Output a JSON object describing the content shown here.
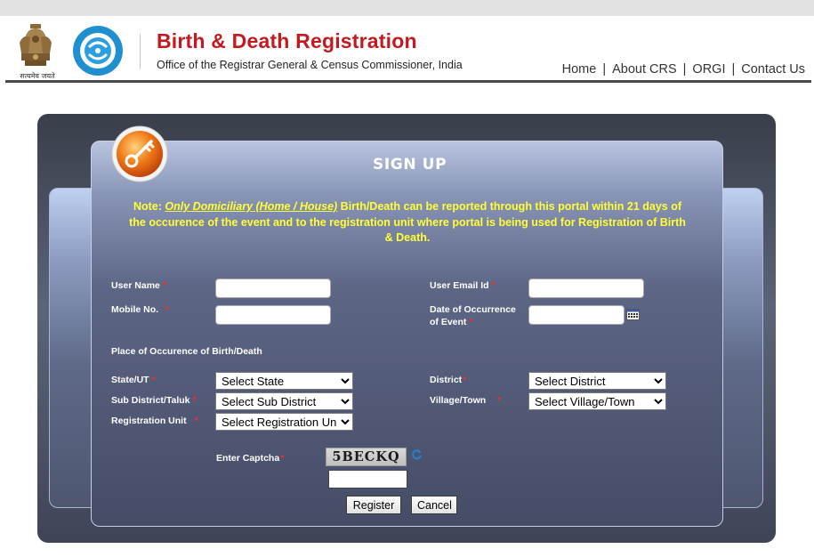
{
  "header": {
    "emblem_caption": "सत्यमेव जयते",
    "title": "Birth & Death Registration",
    "subtitle": "Office of the Registrar General & Census Commissioner, India",
    "nav": [
      "Home",
      "About CRS",
      "ORGI",
      "Contact Us"
    ],
    "title_color": "#c4191f"
  },
  "form": {
    "heading": "SIGN UP",
    "note": {
      "prefix": "Note: ",
      "emphasis": "Only Domiciliary (Home / House)",
      "text": " Birth/Death can be reported through this portal within 21 days of the occurence of the event and to the registration unit where portal is being used for Registration of Birth & Death.",
      "color": "#ffff33"
    },
    "user_name_label": "User Name",
    "email_label": "User Email Id",
    "mobile_label": "Mobile No.",
    "doe_label_line1": "Date of Occurrence",
    "doe_label_line2": "of Event",
    "place_heading": "Place of Occurence of Birth/Death",
    "state_label": "State/UT",
    "district_label": "District",
    "subdistrict_label": "Sub District/Taluk",
    "village_label": "Village/Town",
    "regunit_label": "Registration Unit",
    "state_value": "Select State",
    "district_value": "Select District",
    "subdistrict_value": "Select Sub District",
    "village_value": "Select Village/Town",
    "regunit_value": "Select Registration Unit",
    "captcha_label": "Enter Captcha",
    "captcha_text": "5BECKQ",
    "register_label": "Register",
    "cancel_label": "Cancel",
    "required_marker": "*",
    "required_color": "#ff2a2a"
  },
  "icons": [
    "emblem-icon",
    "crs-logo-icon",
    "key-icon",
    "calendar-icon",
    "refresh-icon"
  ]
}
